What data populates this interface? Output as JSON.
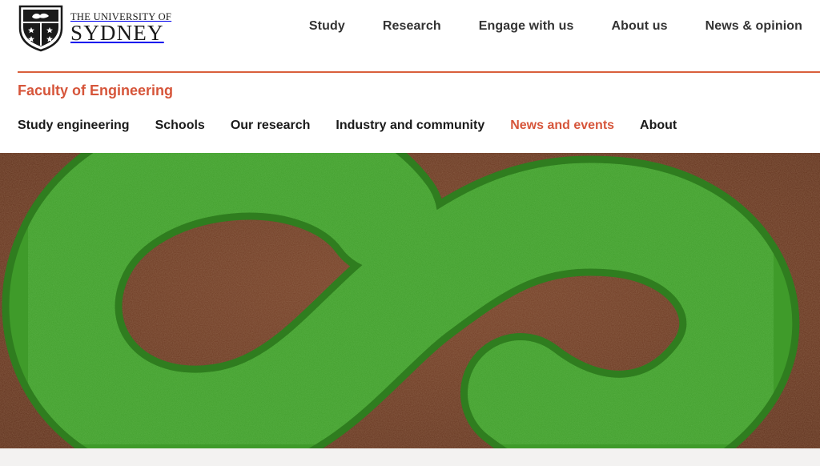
{
  "header": {
    "logo": {
      "line1": "THE UNIVERSITY OF",
      "line2": "SYDNEY"
    },
    "nav": [
      {
        "label": "Study"
      },
      {
        "label": "Research"
      },
      {
        "label": "Engage with us"
      },
      {
        "label": "About us"
      },
      {
        "label": "News & opinion"
      }
    ]
  },
  "faculty": {
    "title": "Faculty of Engineering"
  },
  "subnav": [
    {
      "label": "Study engineering",
      "active": false
    },
    {
      "label": "Schools",
      "active": false
    },
    {
      "label": "Our research",
      "active": false
    },
    {
      "label": "Industry and community",
      "active": false
    },
    {
      "label": "News and events",
      "active": true
    },
    {
      "label": "About",
      "active": false
    }
  ],
  "hero": {
    "image": "grass-infinity-symbol-on-soil"
  },
  "colors": {
    "accent": "#d6553a",
    "grass": "#3f9b2a",
    "soil": "#6e3a22"
  }
}
